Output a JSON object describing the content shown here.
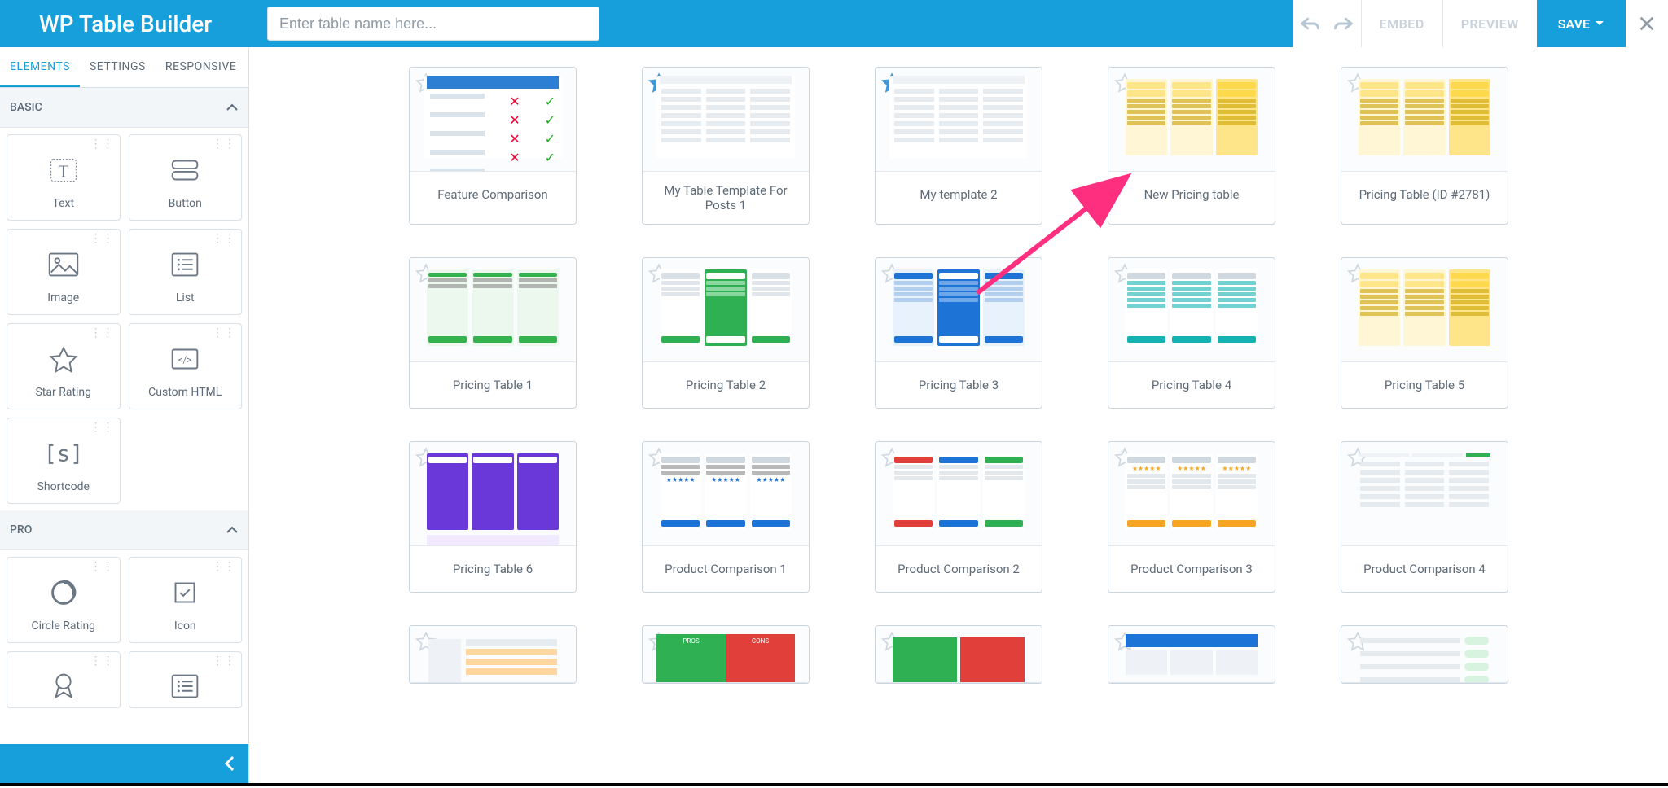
{
  "app": {
    "title": "WP Table Builder"
  },
  "topbar": {
    "search_placeholder": "Enter table name here...",
    "embed": "EMBED",
    "preview": "PREVIEW",
    "save": "SAVE"
  },
  "sidebar": {
    "tabs": {
      "elements": "ELEMENTS",
      "settings": "SETTINGS",
      "responsive": "RESPONSIVE"
    },
    "sections": {
      "basic": "BASIC",
      "pro": "PRO"
    },
    "basic_items": [
      {
        "key": "text",
        "label": "Text"
      },
      {
        "key": "button",
        "label": "Button"
      },
      {
        "key": "image",
        "label": "Image"
      },
      {
        "key": "list",
        "label": "List"
      },
      {
        "key": "star_rating",
        "label": "Star Rating"
      },
      {
        "key": "custom_html",
        "label": "Custom HTML"
      },
      {
        "key": "shortcode",
        "label": "Shortcode"
      }
    ],
    "pro_items": [
      {
        "key": "circle_rating",
        "label": "Circle Rating"
      },
      {
        "key": "icon",
        "label": "Icon"
      },
      {
        "key": "ribbon",
        "label": ""
      },
      {
        "key": "styled_list",
        "label": ""
      }
    ]
  },
  "templates": [
    {
      "key": "feature_comparison",
      "label": "Feature Comparison",
      "fav": false,
      "palette": "blue-table"
    },
    {
      "key": "my_table_template_2",
      "label": "My Table Template For Posts 1",
      "fav": true,
      "palette": "grey-rows"
    },
    {
      "key": "my_template_2",
      "label": "My template 2",
      "fav": true,
      "palette": "grey-rows"
    },
    {
      "key": "new_pricing_table",
      "label": "New Pricing table",
      "fav": false,
      "palette": "yellow-cols"
    },
    {
      "key": "pricing_table_2781",
      "label": "Pricing Table (ID #2781)",
      "fav": false,
      "palette": "yellow-cols"
    },
    {
      "key": "pricing_table_1",
      "label": "Pricing Table 1",
      "fav": false,
      "palette": "green3"
    },
    {
      "key": "pricing_table_2",
      "label": "Pricing Table 2",
      "fav": false,
      "palette": "green-center"
    },
    {
      "key": "pricing_table_3",
      "label": "Pricing Table 3",
      "fav": false,
      "palette": "blue-cols"
    },
    {
      "key": "pricing_table_4",
      "label": "Pricing Table 4",
      "fav": false,
      "palette": "teal-list"
    },
    {
      "key": "pricing_table_5",
      "label": "Pricing Table 5",
      "fav": false,
      "palette": "yellow-cols"
    },
    {
      "key": "pricing_table_6",
      "label": "Pricing Table 6",
      "fav": false,
      "palette": "purple-cols"
    },
    {
      "key": "product_comparison_1",
      "label": "Product Comparison 1",
      "fav": false,
      "palette": "blue-buynow"
    },
    {
      "key": "product_comparison_2",
      "label": "Product Comparison 2",
      "fav": false,
      "palette": "rgb-cols"
    },
    {
      "key": "product_comparison_3",
      "label": "Product Comparison 3",
      "fav": false,
      "palette": "orange-stars"
    },
    {
      "key": "product_comparison_4",
      "label": "Product Comparison 4",
      "fav": false,
      "palette": "specs"
    },
    {
      "key": "row4a",
      "label": "",
      "fav": false,
      "palette": "peach"
    },
    {
      "key": "row4b",
      "label": "",
      "fav": false,
      "palette": "proscons"
    },
    {
      "key": "row4c",
      "label": "",
      "fav": false,
      "palette": "proscons2"
    },
    {
      "key": "row4d",
      "label": "",
      "fav": false,
      "palette": "blue-head"
    },
    {
      "key": "row4e",
      "label": "",
      "fav": false,
      "palette": "price-lines"
    }
  ]
}
